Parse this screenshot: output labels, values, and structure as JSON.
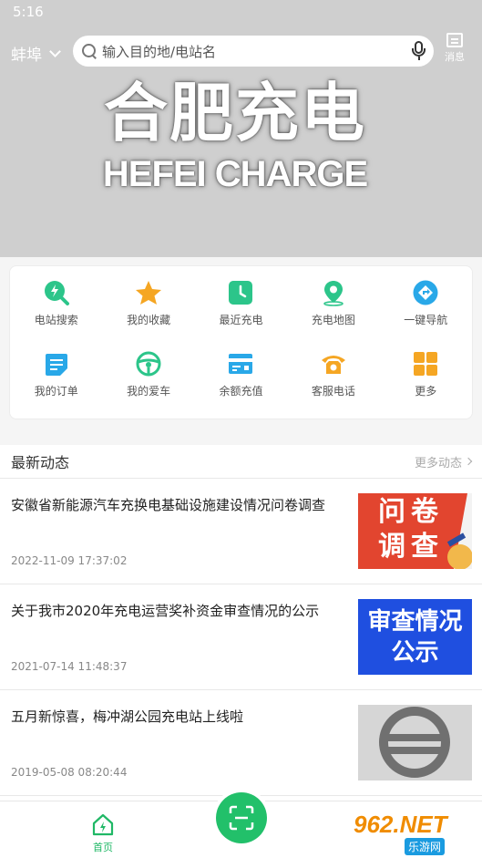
{
  "status_bar": {
    "time": "5:16"
  },
  "header": {
    "city": "蚌埠",
    "search_placeholder": "输入目的地/电站名",
    "message_label": "消息"
  },
  "banner": {
    "logo_cn": "合肥充电",
    "logo_en": "HEFEI CHARGE"
  },
  "quick_menu": [
    {
      "label": "电站搜索",
      "icon": "station-search-icon",
      "color": "#2cc58a"
    },
    {
      "label": "我的收藏",
      "icon": "star-icon",
      "color": "#f5a623"
    },
    {
      "label": "最近充电",
      "icon": "clock-icon",
      "color": "#2cc58a"
    },
    {
      "label": "充电地图",
      "icon": "map-pin-icon",
      "color": "#2cc58a"
    },
    {
      "label": "一键导航",
      "icon": "navigation-icon",
      "color": "#29a8e8"
    },
    {
      "label": "我的订单",
      "icon": "order-icon",
      "color": "#29a8e8"
    },
    {
      "label": "我的爱车",
      "icon": "steering-wheel-icon",
      "color": "#2cc58a"
    },
    {
      "label": "余额充值",
      "icon": "wallet-card-icon",
      "color": "#29a8e8"
    },
    {
      "label": "客服电话",
      "icon": "phone-icon",
      "color": "#f5a623"
    },
    {
      "label": "更多",
      "icon": "more-grid-icon",
      "color": "#f5a623"
    }
  ],
  "news": {
    "title": "最新动态",
    "more_label": "更多动态",
    "items": [
      {
        "title": "安徽省新能源汽车充换电基础设施建设情况问卷调查",
        "date": "2022-11-09 17:37:02",
        "thumb_text": "问卷调查"
      },
      {
        "title": "关于我市2020年充电运营奖补资金审查情况的公示",
        "date": "2021-07-14 11:48:37",
        "thumb_text_1": "审查情况",
        "thumb_text_2": "公示"
      },
      {
        "title": "五月新惊喜，梅冲湖公园充电站上线啦",
        "date": "2019-05-08 08:20:44",
        "thumb_icon": "charge-logo-icon"
      }
    ]
  },
  "bottom_nav": {
    "home_label": "首页",
    "scan_icon": "scan-icon",
    "watermark_big": "962.NET",
    "watermark_small": "乐游网"
  },
  "colors": {
    "accent": "#22c06a",
    "hero_bg": "#cfcfcf"
  }
}
